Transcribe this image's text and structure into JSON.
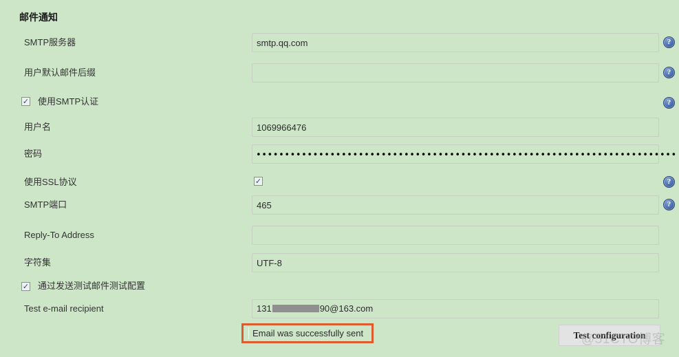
{
  "page": {
    "background_color": "#cde6c8",
    "title": "邮件通知"
  },
  "fields": [
    {
      "label": "SMTP服务器",
      "value": "smtp.qq.com",
      "placeholder": "",
      "has_help": true,
      "type": "text"
    },
    {
      "label": "用户默认邮件后缀",
      "value": "",
      "placeholder": "",
      "has_help": true,
      "type": "text"
    },
    {
      "label": "用户名",
      "value": "1069966476",
      "placeholder": "",
      "has_help": false,
      "type": "text"
    },
    {
      "label": "密码",
      "value": "••••••••••••••••••••••••••••••••••••••••••••••••••••••••••••••••••••••••••••",
      "placeholder": "",
      "has_help": false,
      "type": "password"
    },
    {
      "label": "SMTP端口",
      "value": "465",
      "placeholder": "",
      "has_help": true,
      "type": "text"
    },
    {
      "label": "Reply-To Address",
      "value": "",
      "placeholder": "",
      "has_help": false,
      "type": "text"
    },
    {
      "label": "字符集",
      "value": "UTF-8",
      "placeholder": "",
      "has_help": false,
      "type": "text"
    }
  ],
  "checkboxes": {
    "smtp_auth": {
      "label": "使用SMTP认证",
      "checked": true,
      "check_glyph": "✓",
      "has_help": true
    },
    "use_ssl": {
      "label": "使用SSL协议",
      "checked": true,
      "check_glyph": "✓",
      "has_help": true
    },
    "send_test_mail": {
      "label": "通过发送测试邮件测试配置",
      "checked": true,
      "check_glyph": "✓",
      "has_help": false
    }
  },
  "test_recipient": {
    "label": "Test e-mail recipient",
    "value_prefix": "131",
    "value_suffix": "90@163.com",
    "redacted": true
  },
  "status": {
    "message": "Email was successfully sent",
    "highlight_color": "#df5a2e"
  },
  "buttons": {
    "test_configuration": "Test configuration"
  },
  "icons": {
    "help_glyph": "?"
  },
  "watermark": {
    "text": "@51CTO博客"
  }
}
